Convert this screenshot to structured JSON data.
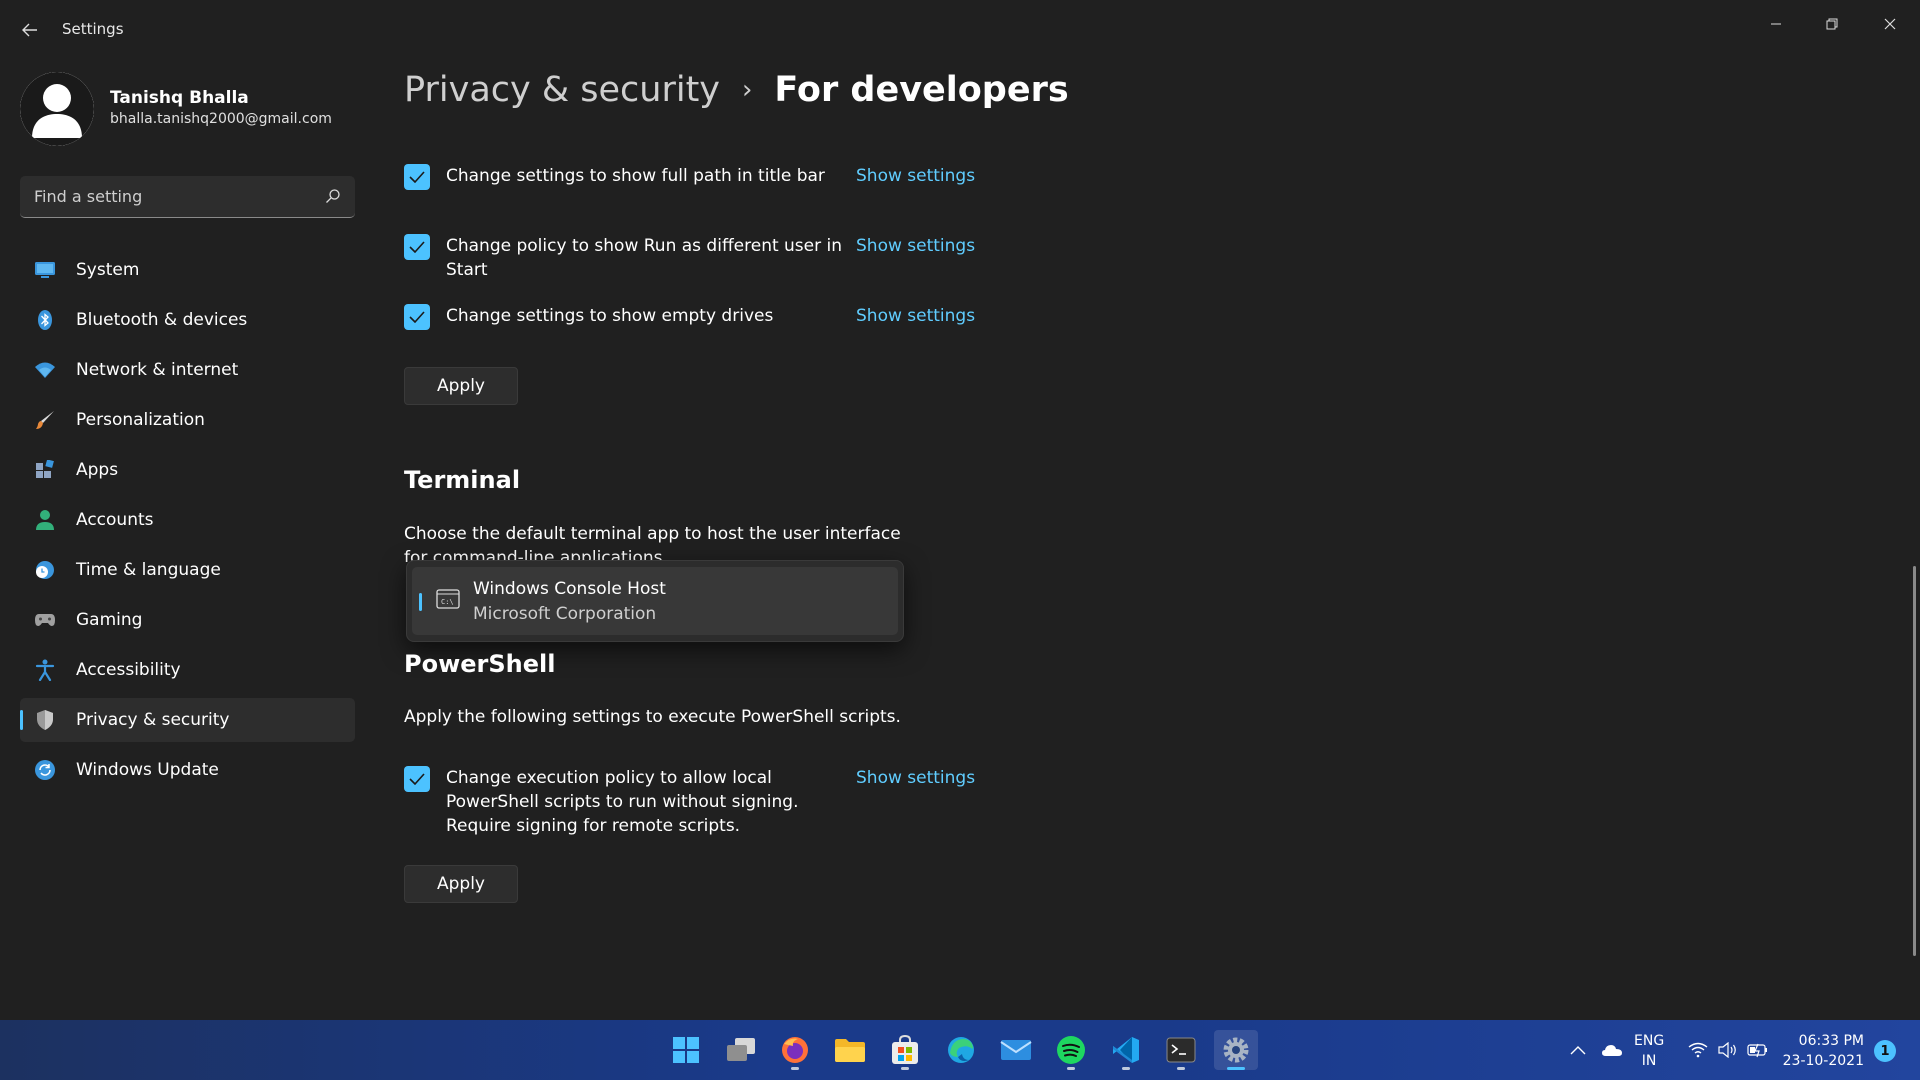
{
  "window": {
    "title": "Settings",
    "controls": [
      "minimize-icon",
      "restore-icon",
      "close-icon"
    ]
  },
  "profile": {
    "name": "Tanishq Bhalla",
    "email": "bhalla.tanishq2000@gmail.com"
  },
  "search": {
    "placeholder": "Find a setting"
  },
  "nav": {
    "items": [
      {
        "label": "System",
        "icon": "monitor-icon",
        "color": "#3a96dd"
      },
      {
        "label": "Bluetooth & devices",
        "icon": "bluetooth-icon",
        "color": "#3a96dd"
      },
      {
        "label": "Network & internet",
        "icon": "wifi-icon",
        "color": "#3a96dd"
      },
      {
        "label": "Personalization",
        "icon": "brush-icon",
        "color": "#e8893a"
      },
      {
        "label": "Apps",
        "icon": "apps-icon",
        "color": "#8fa5c4"
      },
      {
        "label": "Accounts",
        "icon": "person-icon",
        "color": "#32b07a"
      },
      {
        "label": "Time & language",
        "icon": "globe-clock-icon",
        "color": "#3a96dd"
      },
      {
        "label": "Gaming",
        "icon": "gamepad-icon",
        "color": "#a0a0a0"
      },
      {
        "label": "Accessibility",
        "icon": "accessibility-icon",
        "color": "#3a96dd"
      },
      {
        "label": "Privacy & security",
        "icon": "shield-icon",
        "color": "#9a9a9a"
      },
      {
        "label": "Windows Update",
        "icon": "update-icon",
        "color": "#3a96dd"
      }
    ],
    "active": "Privacy & security"
  },
  "breadcrumb": {
    "parent": "Privacy & security",
    "separator": "›",
    "current": "For developers"
  },
  "explorer_settings": [
    {
      "label": "Change settings to show full path in title bar",
      "checked": true,
      "link": "Show settings"
    },
    {
      "label": "Change policy to show Run as different user in Start",
      "checked": true,
      "link": "Show settings"
    },
    {
      "label": "Change settings to show empty drives",
      "checked": true,
      "link": "Show settings"
    }
  ],
  "apply_label": "Apply",
  "terminal": {
    "title": "Terminal",
    "description": "Choose the default terminal app to host the user interface for command-line applications",
    "dropdown": {
      "name": "Windows Console Host",
      "publisher": "Microsoft Corporation",
      "icon": "console-icon"
    }
  },
  "powershell": {
    "title": "PowerShell",
    "description": "Apply the following settings to execute PowerShell scripts.",
    "setting": {
      "label": "Change execution policy to allow local PowerShell scripts to run without signing. Require signing for remote scripts.",
      "checked": true,
      "link": "Show settings"
    },
    "apply_label": "Apply"
  },
  "taskbar": {
    "apps": [
      "start-icon",
      "task-view-icon",
      "firefox-icon",
      "file-explorer-icon",
      "store-icon",
      "edge-icon",
      "mail-icon",
      "spotify-icon",
      "vscode-icon",
      "terminal-icon",
      "settings-gear-icon"
    ],
    "active_app": "settings-gear-icon",
    "tray": {
      "lang_line1": "ENG",
      "lang_line2": "IN",
      "time": "06:33 PM",
      "date": "23-10-2021",
      "notifications": "1"
    }
  },
  "colors": {
    "accent": "#4cc2ff",
    "link": "#60cdff",
    "background": "#202020"
  }
}
